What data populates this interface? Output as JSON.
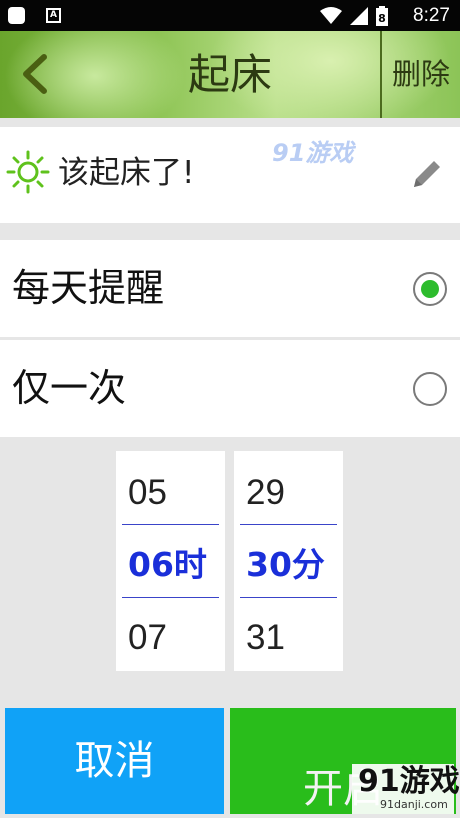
{
  "status_bar": {
    "time": "8:27",
    "icons": [
      "app-notification-icon",
      "a-notification-icon",
      "wifi-icon",
      "signal-icon",
      "battery-icon"
    ],
    "battery_glyph": "8"
  },
  "header": {
    "title": "起床",
    "delete_label": "删除",
    "colors": {
      "bar": "#8fc556",
      "text": "#2c3a12"
    }
  },
  "alarm_label": {
    "text": "该起床了!",
    "watermark": "91游戏"
  },
  "repeat_options": [
    {
      "label": "每天提醒",
      "selected": true
    },
    {
      "label": "仅一次",
      "selected": false
    }
  ],
  "time_picker": {
    "hour": {
      "prev": "05",
      "current": "06时",
      "next": "07"
    },
    "minute": {
      "prev": "29",
      "current": "30分",
      "next": "31"
    },
    "accent": "#1a2fd9"
  },
  "actions": {
    "cancel_label": "取消",
    "start_label": "开启",
    "cancel_color": "#10a2f7",
    "start_color": "#29bd1b"
  },
  "watermark": {
    "main": "91游戏",
    "sub": "91danji.com"
  }
}
